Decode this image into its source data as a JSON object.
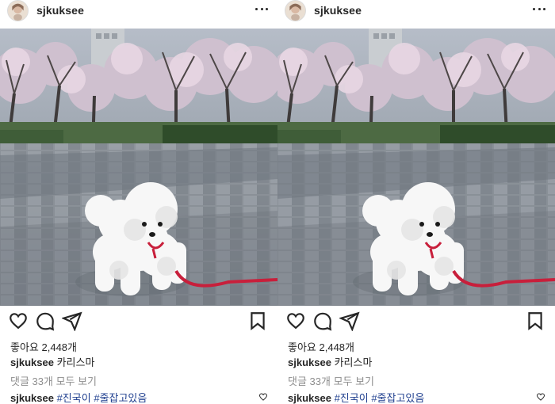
{
  "posts": [
    {
      "username": "sjkuksee",
      "likes": "좋아요 2,448개",
      "caption": {
        "user": "sjkuksee",
        "text": "카리스마"
      },
      "view_comments": "댓글 33개 모두 보기",
      "comment": {
        "user": "sjkuksee",
        "tag1": "#진국이",
        "tag2": "#줄잡고있음"
      }
    },
    {
      "username": "sjkuksee",
      "likes": "좋아요 2,448개",
      "caption": {
        "user": "sjkuksee",
        "text": "카리스마"
      },
      "view_comments": "댓글 33개 모두 보기",
      "comment": {
        "user": "sjkuksee",
        "tag1": "#진국이",
        "tag2": "#줄잡고있음"
      }
    }
  ],
  "icons": [
    "more-icon",
    "heart-icon",
    "comment-icon",
    "share-icon",
    "bookmark-icon",
    "small-heart-icon"
  ],
  "colors": {
    "text": "#262626",
    "muted": "#8e8e8e",
    "hashtag": "#1f3f8f",
    "leash": "#c81f3b"
  }
}
